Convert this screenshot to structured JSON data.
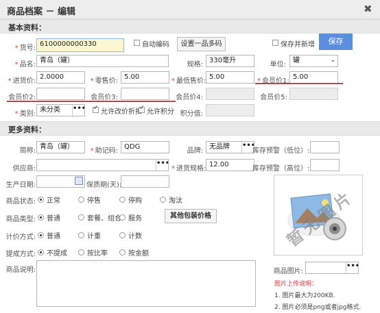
{
  "window": {
    "title": "商品档案 － 编辑",
    "close_icon": "close-icon"
  },
  "sections": {
    "basic": "基本资料：",
    "more": "更多资料："
  },
  "basic": {
    "code_label": "货号:",
    "code_value": "6100000000330",
    "auto_code_label": "自动编码",
    "multi_code_button": "设置一品多码",
    "save_new_label": "保存并新增",
    "save_button": "保存",
    "name_label": "品名:",
    "name_value": "青岛（罐）",
    "spec_label": "规格:",
    "spec_value": "330毫升",
    "unit_label": "单位:",
    "unit_value": "罐",
    "cost_label": "进货价:",
    "cost_value": "2.0000",
    "retail_label": "零售价:",
    "retail_value": "5.00",
    "min_price_label": "最低售价:",
    "min_price_value": "5.00",
    "member1_label": "会员价1:",
    "member1_value": "5.00",
    "member2_label": "会员价2:",
    "member2_value": "",
    "member3_label": "会员价3:",
    "member3_value": "",
    "member4_label": "会员价4:",
    "member4_value": "",
    "member5_label": "会员价5:",
    "member5_value": "",
    "category_label": "类别:",
    "category_value": "未分类",
    "allow_discount_label": "允许改价折扣",
    "allow_points_label": "允许积分",
    "points_label": "积分值:",
    "points_value": ""
  },
  "more": {
    "short_name_label": "简称:",
    "short_name_value": "青岛（罐）",
    "mnemonic_label": "助记码:",
    "mnemonic_value": "QDG",
    "brand_label": "品牌:",
    "brand_value": "无品牌",
    "stock_low_label": "库存预警（低位）:",
    "supplier_label": "供应商:",
    "supplier_value": "",
    "purchase_spec_label": "进货规格:",
    "purchase_spec_value": "12.00",
    "stock_high_label": "库存预警（高位）:",
    "production_date_label": "生产日期:",
    "shelf_life_label": "保质期(天):",
    "status_label": "商品状态:",
    "status_options": [
      "正常",
      "停售",
      "停购",
      "淘汰"
    ],
    "type_label": "商品类型:",
    "type_options": [
      "普通",
      "套餐、组合",
      "服务"
    ],
    "other_pack_button": "其他包装价格",
    "pricing_label": "计价方式:",
    "pricing_options": [
      "普通",
      "计重",
      "计数"
    ],
    "commission_label": "提成方式:",
    "commission_options": [
      "不提成",
      "按比率",
      "按金额"
    ],
    "desc_label": "商品说明:",
    "image_label": "商品图片:",
    "placeholder_text": "暂无图片",
    "upload_title": "图片上传说明：",
    "upload_note1": "1. 图片最大为200KB.",
    "upload_note2": "2. 图片必须是png或者jpg格式."
  },
  "colors": {
    "accent": "#5b8ee0",
    "required": "#e0433a",
    "underline": "#d9363e"
  }
}
